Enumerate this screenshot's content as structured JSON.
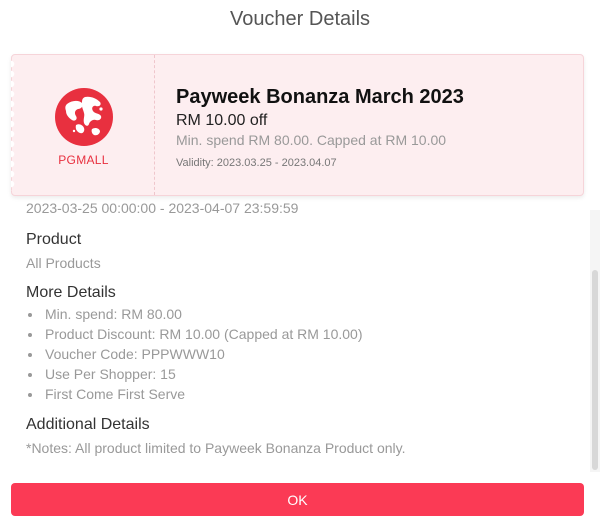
{
  "dialog": {
    "title": "Voucher Details"
  },
  "voucher": {
    "brand": "PGMALL",
    "title": "Payweek Bonanza March 2023",
    "amount": "RM 10.00 off",
    "min_spend": "Min. spend RM 80.00. Capped at RM 10.00",
    "validity": "Validity: 2023.03.25 - 2023.04.07",
    "icon": "globe-logo-icon",
    "accent_color": "#e8303f"
  },
  "details": {
    "cut_off_text": "2023-03-25 00:00:00 - 2023-04-07 23:59:59",
    "product_title": "Product",
    "product_value": "All Products",
    "more_title": "More Details",
    "more_items": [
      "Min. spend: RM 80.00",
      "Product Discount: RM 10.00 (Capped at RM 10.00)",
      "Voucher Code: PPPWWW10",
      "Use Per Shopper: 15",
      "First Come First Serve"
    ],
    "additional_title": "Additional Details",
    "additional_text": "*Notes: All product limited to Payweek Bonanza Product only."
  },
  "actions": {
    "ok_label": "OK",
    "ok_color": "#fb3a55"
  }
}
